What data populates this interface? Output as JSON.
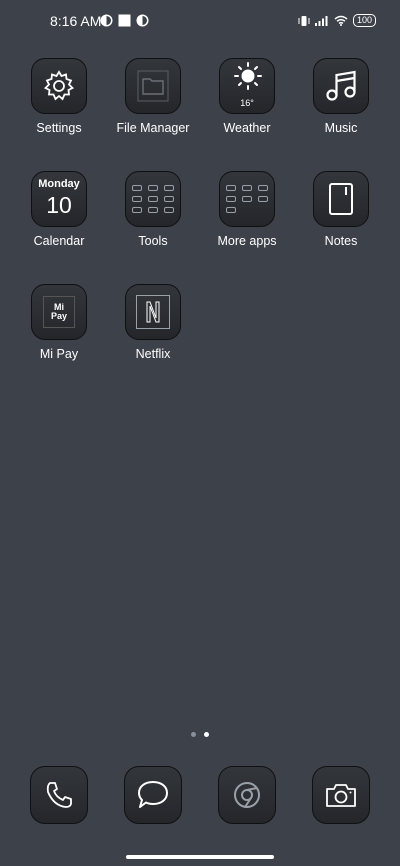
{
  "status_bar": {
    "time": "8:16 AM",
    "battery": "100",
    "notification_icons": [
      "app-notification-icon",
      "square-notification-icon",
      "app-notification-icon"
    ],
    "system_icons": [
      "vibrate-icon",
      "signal-icon",
      "wifi-icon",
      "battery-icon"
    ]
  },
  "apps": [
    {
      "label": "Settings",
      "icon": "gear-icon"
    },
    {
      "label": "File Manager",
      "icon": "folder-icon"
    },
    {
      "label": "Weather",
      "icon": "sun-icon",
      "temp": "16°"
    },
    {
      "label": "Music",
      "icon": "music-note-icon"
    },
    {
      "label": "Calendar",
      "icon": "calendar-icon",
      "day": "Monday",
      "date": "10"
    },
    {
      "label": "Tools",
      "icon": "tools-folder-icon"
    },
    {
      "label": "More apps",
      "icon": "apps-folder-icon"
    },
    {
      "label": "Notes",
      "icon": "note-icon"
    },
    {
      "label": "Mi Pay",
      "icon": "mi-pay-icon",
      "logo_top": "Mi",
      "logo_bottom": "Pay"
    },
    {
      "label": "Netflix",
      "icon": "netflix-icon",
      "logo": "N"
    }
  ],
  "pages": {
    "count": 2,
    "active": 2
  },
  "dock": [
    {
      "name": "phone",
      "icon": "phone-icon"
    },
    {
      "name": "messages",
      "icon": "chat-bubble-icon"
    },
    {
      "name": "browser",
      "icon": "chrome-icon"
    },
    {
      "name": "camera",
      "icon": "camera-icon"
    }
  ],
  "colors": {
    "background": "#3d414a",
    "icon_bg": "#2c2e32",
    "text": "#ffffff"
  }
}
